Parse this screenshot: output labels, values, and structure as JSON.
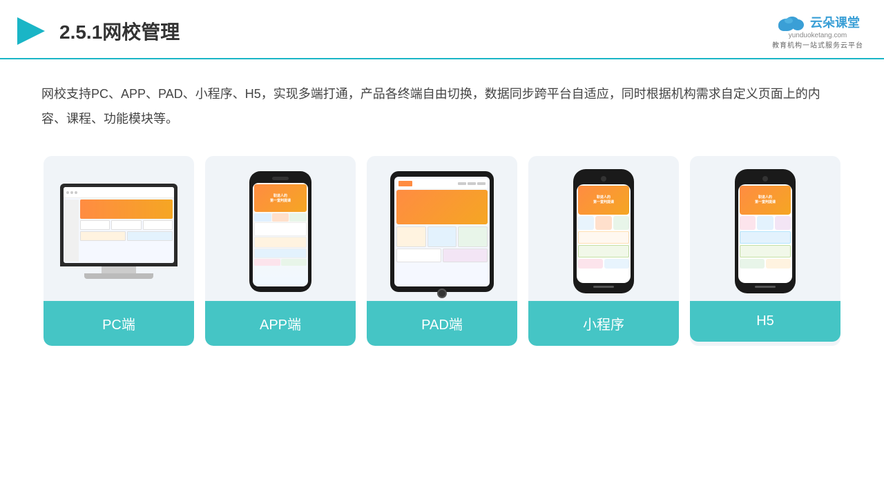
{
  "header": {
    "title": "2.5.1网校管理",
    "logo_text": "云朵课堂",
    "logo_domain": "yunduoketang.com",
    "logo_tagline": "教育机构一站式服务云平台"
  },
  "description": {
    "text": "网校支持PC、APP、PAD、小程序、H5，实现多端打通，产品各终端自由切换，数据同步跨平台自适应，同时根据机构需求自定义页面上的内容、课程、功能模块等。"
  },
  "cards": [
    {
      "id": "pc",
      "label": "PC端"
    },
    {
      "id": "app",
      "label": "APP端"
    },
    {
      "id": "pad",
      "label": "PAD端"
    },
    {
      "id": "miniprogram",
      "label": "小程序"
    },
    {
      "id": "h5",
      "label": "H5"
    }
  ],
  "colors": {
    "accent": "#45c5c5",
    "header_line": "#1ab5c6",
    "card_bg": "#f0f4f8",
    "logo_blue": "#3a9fd6"
  }
}
